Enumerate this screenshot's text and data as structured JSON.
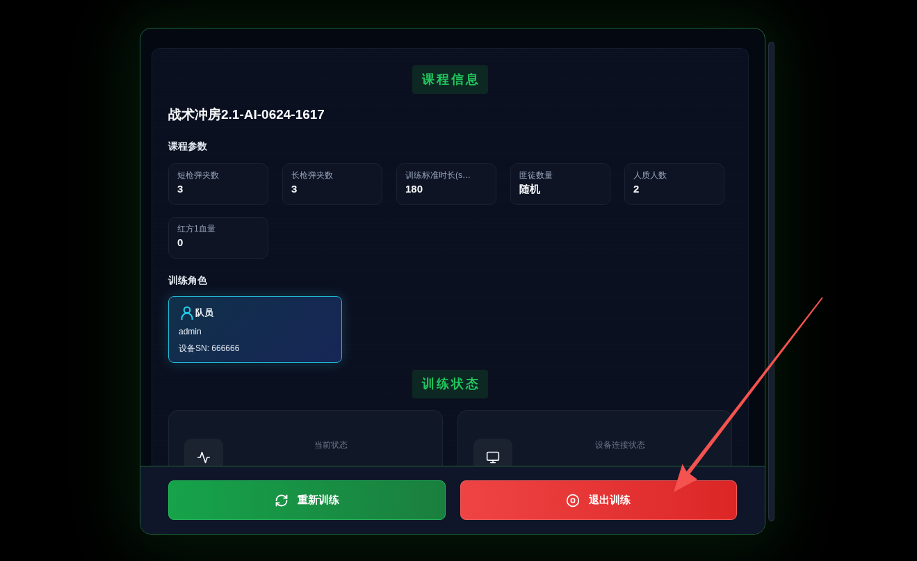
{
  "dialog": {
    "course_info": {
      "heading": "课程信息",
      "title": "战术冲房2.1-AI-0624-1617",
      "params_heading": "课程参数",
      "params": [
        {
          "label": "短枪弹夹数",
          "value": "3"
        },
        {
          "label": "长枪弹夹数",
          "value": "3"
        },
        {
          "label": "训练标准时长(s…",
          "value": "180"
        },
        {
          "label": "匪徒数量",
          "value": "随机"
        },
        {
          "label": "人质人数",
          "value": "2"
        },
        {
          "label": "红方1血量",
          "value": "0"
        }
      ],
      "roles_heading": "训练角色",
      "roles": [
        {
          "role": "队员",
          "user": "admin",
          "device": "设备SN: 666666",
          "selected": true
        }
      ]
    },
    "training_status": {
      "heading": "训练状态",
      "cards": [
        {
          "kind": "activity",
          "label": "当前状态"
        },
        {
          "kind": "device",
          "label": "设备连接状态"
        }
      ]
    },
    "footer": {
      "buttons": [
        {
          "kind": "restart",
          "label": "重新训练"
        },
        {
          "kind": "exit",
          "label": "退出训练"
        }
      ]
    }
  }
}
